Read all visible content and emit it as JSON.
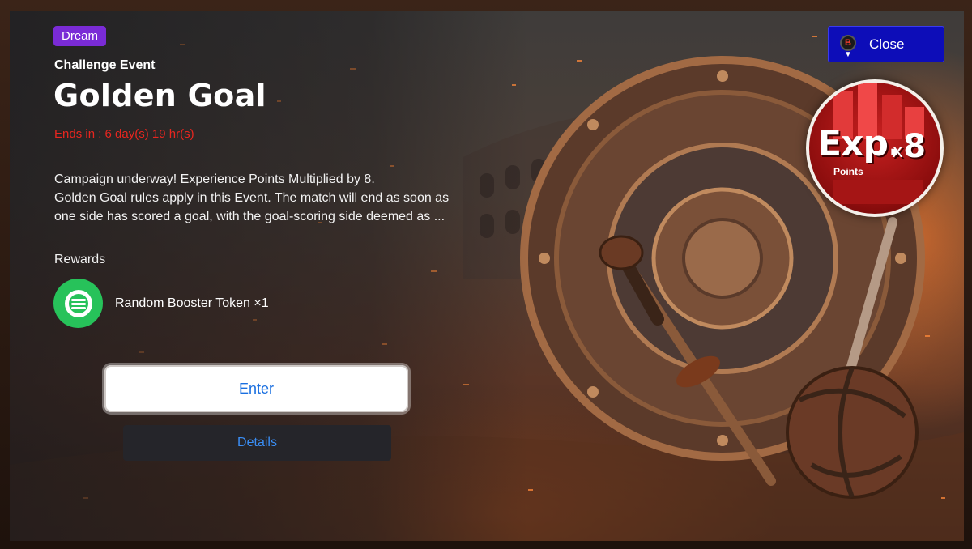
{
  "event": {
    "tag": "Dream",
    "kicker": "Challenge Event",
    "title": "Golden Goal",
    "ends_in": "Ends in : 6 day(s) 19 hr(s)",
    "description_line1": "Campaign underway! Experience Points Multiplied by 8.",
    "description_line2": "Golden Goal rules apply in this Event. The match will end as soon as",
    "description_line3": "one side has scored a goal, with the goal-scoring side deemed as ..."
  },
  "rewards": {
    "label": "Rewards",
    "items": [
      {
        "name": "Random Booster Token ×1",
        "icon": "booster-token-icon"
      }
    ]
  },
  "buttons": {
    "enter": "Enter",
    "details": "Details",
    "close": "Close",
    "close_key": "B"
  },
  "exp_badge": {
    "main": "Exp.",
    "multiplier_x": "x",
    "multiplier": "8",
    "sub": "Points"
  },
  "colors": {
    "tag_bg": "#7a2bd6",
    "ends_text": "#e8261f",
    "reward_icon_bg": "#27c25a",
    "close_bg": "#0d0db8",
    "enter_text": "#1a6fe0",
    "details_text": "#3a8ef5",
    "exp_badge_red": "#c72020"
  }
}
